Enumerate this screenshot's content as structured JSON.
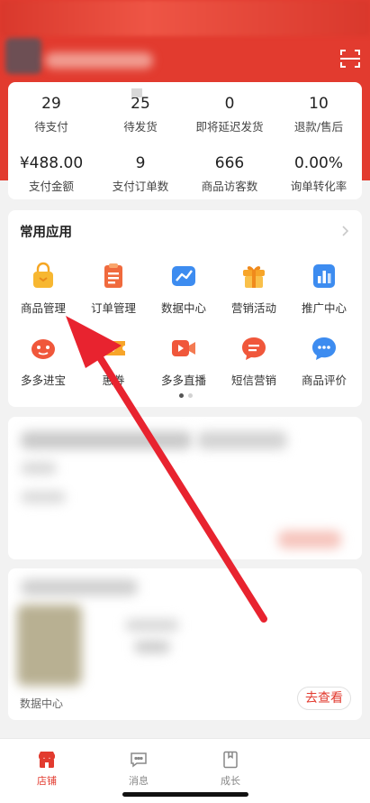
{
  "stats": [
    {
      "value": "29",
      "label": "待支付"
    },
    {
      "value": "25",
      "label": "待发货"
    },
    {
      "value": "0",
      "label": "即将延迟发货"
    },
    {
      "value": "10",
      "label": "退款/售后"
    },
    {
      "value": "¥488.00",
      "label": "支付金额"
    },
    {
      "value": "9",
      "label": "支付订单数"
    },
    {
      "value": "666",
      "label": "商品访客数"
    },
    {
      "value": "0.00%",
      "label": "询单转化率"
    }
  ],
  "apps": {
    "title": "常用应用",
    "items": [
      {
        "label": "商品管理",
        "icon": "shopping-bag-icon"
      },
      {
        "label": "订单管理",
        "icon": "order-list-icon"
      },
      {
        "label": "数据中心",
        "icon": "data-chart-icon"
      },
      {
        "label": "营销活动",
        "icon": "gift-box-icon"
      },
      {
        "label": "推广中心",
        "icon": "bar-chart-icon"
      },
      {
        "label": "多多进宝",
        "icon": "piggy-icon"
      },
      {
        "label": "惠券",
        "icon": "coupon-icon"
      },
      {
        "label": "多多直播",
        "icon": "video-camera-icon"
      },
      {
        "label": "短信营销",
        "icon": "message-icon"
      },
      {
        "label": "商品评价",
        "icon": "chat-bubble-icon"
      }
    ],
    "page_indicator": {
      "pages": 2,
      "active": 1
    }
  },
  "data_card": {
    "label": "数据中心",
    "button": "去查看"
  },
  "nav": [
    {
      "label": "店铺",
      "icon": "store-icon",
      "active": true
    },
    {
      "label": "消息",
      "icon": "message-icon",
      "active": false
    },
    {
      "label": "成长",
      "icon": "book-icon",
      "active": false
    }
  ],
  "colors": {
    "brand_red": "#e23b2f",
    "inactive_gray": "#888888"
  }
}
